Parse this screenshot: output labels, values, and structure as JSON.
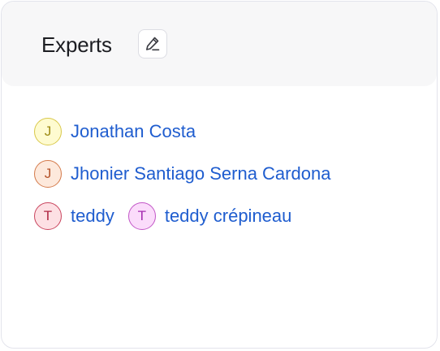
{
  "card": {
    "title": "Experts",
    "edit_icon": "pencil-edit-icon"
  },
  "experts": [
    {
      "initial": "J",
      "name": "Jonathan Costa",
      "avatar_bg": "#fefbd0",
      "avatar_border": "#d9c84a",
      "avatar_text": "#9c8a12"
    },
    {
      "initial": "J",
      "name": "Jhonier Santiago Serna Cardona",
      "avatar_bg": "#fde9dc",
      "avatar_border": "#d47a4a",
      "avatar_text": "#b5532a"
    },
    {
      "initial": "T",
      "name": "teddy",
      "avatar_bg": "#fde0e4",
      "avatar_border": "#c9455e",
      "avatar_text": "#b02744"
    },
    {
      "initial": "T",
      "name": "teddy crépineau",
      "avatar_bg": "#fbdcfb",
      "avatar_border": "#c256c7",
      "avatar_text": "#a52bb0"
    }
  ],
  "colors": {
    "link": "#1f5dcf",
    "header_bg": "#f7f7f8",
    "border": "#e3e4ec"
  }
}
